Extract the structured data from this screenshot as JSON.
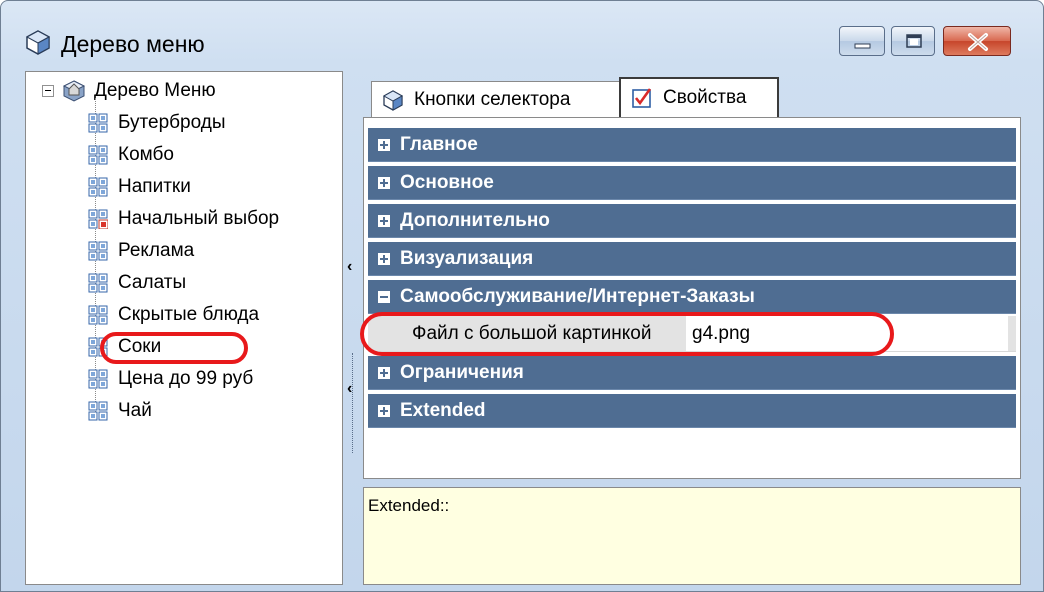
{
  "window": {
    "title": "Дерево меню"
  },
  "tree": {
    "root_label": "Дерево Меню",
    "items": [
      {
        "label": "Бутерброды",
        "icon": "grid-icon"
      },
      {
        "label": "Комбо",
        "icon": "grid-icon"
      },
      {
        "label": "Напитки",
        "icon": "grid-icon"
      },
      {
        "label": "Начальный выбор",
        "icon": "grid-start-icon"
      },
      {
        "label": "Реклама",
        "icon": "grid-icon"
      },
      {
        "label": "Салаты",
        "icon": "grid-icon"
      },
      {
        "label": "Скрытые блюда",
        "icon": "grid-icon"
      },
      {
        "label": "Соки",
        "icon": "grid-icon"
      },
      {
        "label": "Цена до 99 руб",
        "icon": "grid-icon"
      },
      {
        "label": "Чай",
        "icon": "grid-icon"
      }
    ]
  },
  "tabs": [
    {
      "label": "Кнопки селектора",
      "icon": "cube-icon",
      "selected": false
    },
    {
      "label": "Свойства",
      "icon": "checkbox-icon",
      "selected": true
    }
  ],
  "properties": {
    "categories": [
      {
        "label": "Главное",
        "expanded": false
      },
      {
        "label": "Основное",
        "expanded": false
      },
      {
        "label": "Дополнительно",
        "expanded": false
      },
      {
        "label": "Визуализация",
        "expanded": false
      },
      {
        "label": "Самообслуживание/Интернет-Заказы",
        "expanded": true
      },
      {
        "label": "Ограничения",
        "expanded": false
      },
      {
        "label": "Extended",
        "expanded": false
      }
    ],
    "row": {
      "name": "Файл с большой картинкой",
      "value": "g4.png"
    }
  },
  "description": {
    "text": "Extended::"
  },
  "colors": {
    "category_bg": "#4f6d92",
    "highlight": "#e8191b",
    "description_bg": "#ffffe1"
  }
}
